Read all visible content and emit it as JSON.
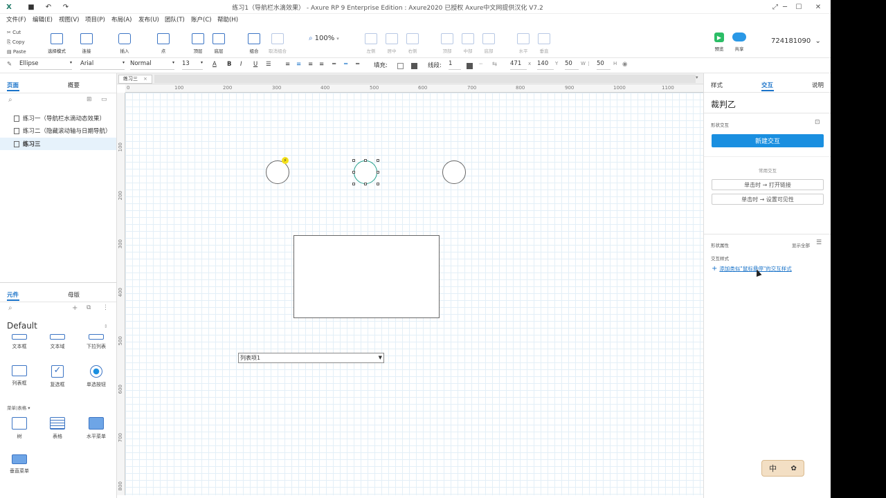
{
  "titlebar": {
    "title": "练习1（导航栏水滴效果） - Axure RP 9 Enterprise Edition : Axure2020 已授权    Axure中文网提供汉化 V7.2",
    "logo": "X"
  },
  "menu": [
    "文件(F)",
    "编辑(E)",
    "视图(V)",
    "项目(P)",
    "布局(A)",
    "发布(U)",
    "团队(T)",
    "账户(C)",
    "帮助(H)"
  ],
  "toolbar": {
    "clip": [
      "Cut",
      "Copy",
      "Paste"
    ],
    "tools": [
      {
        "label": "选择模式",
        "enabled": true
      },
      {
        "label": "连接",
        "enabled": true
      },
      {
        "label": "插入",
        "enabled": true
      },
      {
        "label": "点",
        "enabled": true
      },
      {
        "label": "顶层",
        "enabled": true
      },
      {
        "label": "底层",
        "enabled": true
      },
      {
        "label": "组合",
        "enabled": true
      },
      {
        "label": "取消组合",
        "enabled": false
      },
      {
        "label": "左侧",
        "enabled": false
      },
      {
        "label": "居中",
        "enabled": false
      },
      {
        "label": "右侧",
        "enabled": false
      },
      {
        "label": "顶部",
        "enabled": false
      },
      {
        "label": "中部",
        "enabled": false
      },
      {
        "label": "底部",
        "enabled": false
      },
      {
        "label": "水平",
        "enabled": false
      },
      {
        "label": "垂直",
        "enabled": false
      }
    ],
    "zoom": "100%",
    "preview": "预览",
    "share": "共享",
    "account": "724181090"
  },
  "stylebar": {
    "shape": "Ellipse",
    "font": "Arial",
    "weight": "Normal",
    "size": "13",
    "fill_label": "填充:",
    "line_label": "线段:",
    "line_width": "1",
    "x": "471",
    "x_label": "x",
    "y": "140",
    "y_label": "Y",
    "w": "50",
    "w_label": "W",
    "h": "50",
    "h_label": "H"
  },
  "left": {
    "tabs": [
      "页面",
      "概要"
    ],
    "pages": [
      {
        "label": "练习一（导航栏水滴动态效果）",
        "selected": false
      },
      {
        "label": "练习二（隐藏滚动轴与日期导航）",
        "selected": false
      },
      {
        "label": "练习三",
        "selected": true
      }
    ],
    "lib_tabs": [
      "元件",
      "母版"
    ],
    "library": "Default",
    "widgets": [
      "文本框",
      "文本域",
      "下拉列表",
      "列表框",
      "复选框",
      "单选按钮"
    ],
    "section": "菜单|表格 ▾",
    "widgets2": [
      "树",
      "表格",
      "水平菜单",
      "垂直菜单"
    ]
  },
  "canvas": {
    "tab": "练习三",
    "ruler_h": [
      "0",
      "100",
      "200",
      "300",
      "400",
      "500",
      "600",
      "700",
      "800",
      "900",
      "1000",
      "1100"
    ],
    "ruler_v": [
      "100",
      "200",
      "300",
      "400",
      "500",
      "600",
      "700",
      "800"
    ],
    "dropdown_value": "列表项1"
  },
  "right": {
    "tabs": [
      "样式",
      "交互",
      "说明"
    ],
    "active_tab": "交互",
    "name": "裁判乙",
    "section_label": "形状交互",
    "new_interaction": "新建交互",
    "common_label": "常用交互",
    "common": [
      "单击时 → 打开链接",
      "单击时 → 设置可见性"
    ],
    "props_label": "形状属性",
    "show_all": "显示全部",
    "interaction_style": "交互样式",
    "add_style": "添加类似\"鼠标悬停\"的交互样式"
  },
  "ime": {
    "label": "中"
  },
  "colors": {
    "accent": "#1a8fe0",
    "selection": "#1f9e8a",
    "grid": "#e3eff7"
  }
}
